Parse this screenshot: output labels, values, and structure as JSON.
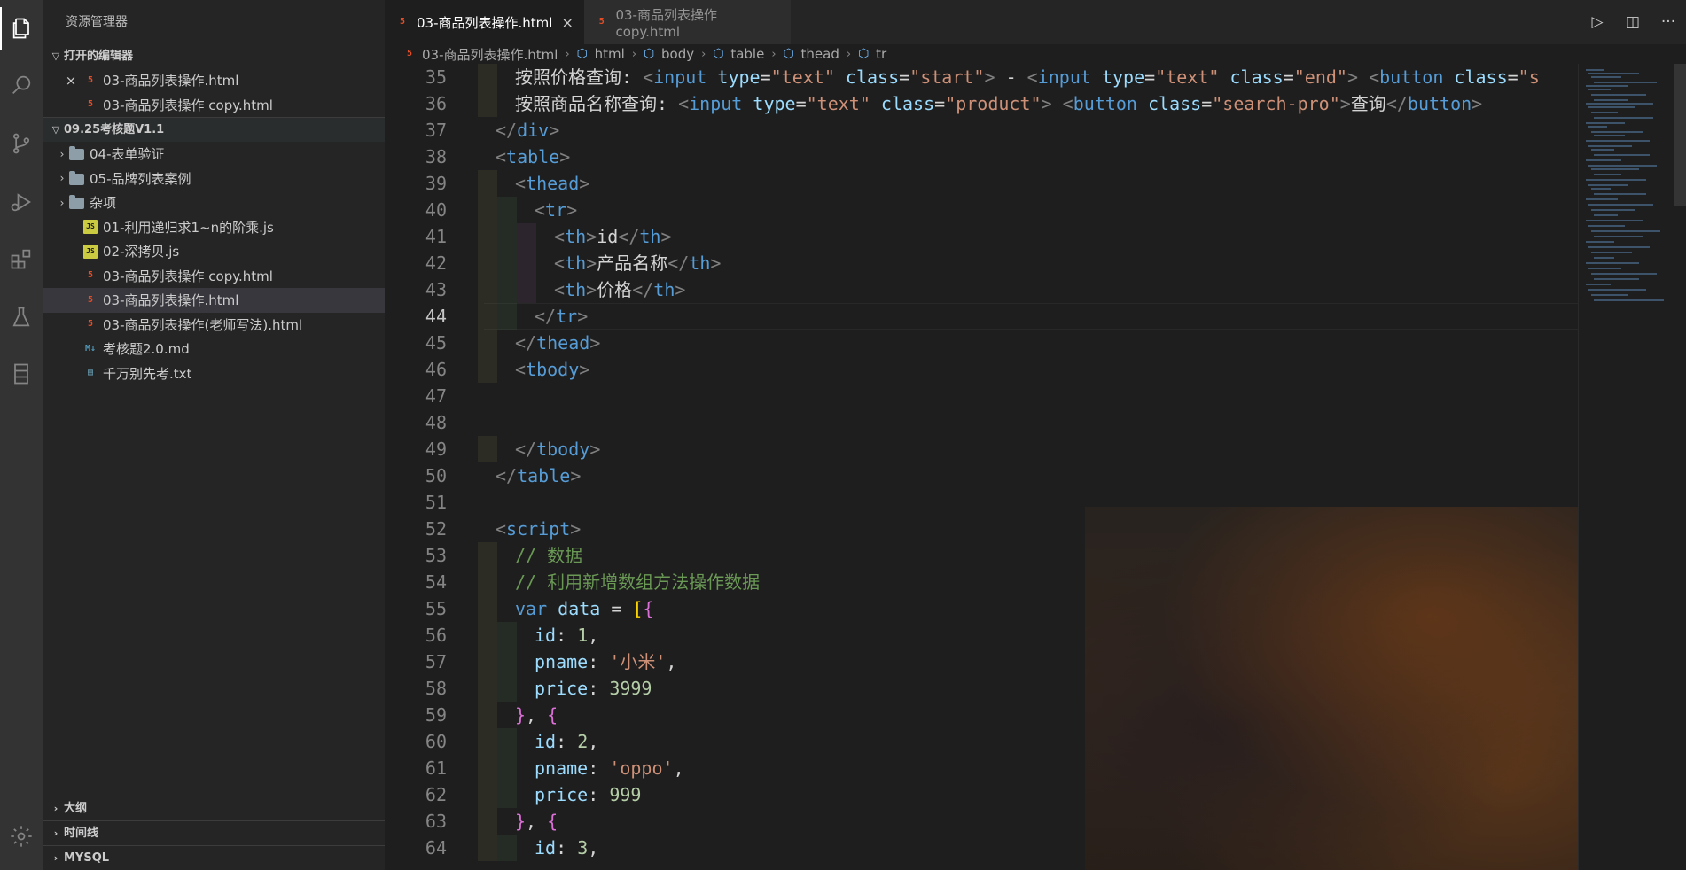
{
  "explorer": {
    "title": "资源管理器",
    "open_editors_header": "打开的编辑器",
    "open_editors": [
      {
        "name": "03-商品列表操作.html",
        "type": "html",
        "closable": true
      },
      {
        "name": "03-商品列表操作 copy.html",
        "type": "html",
        "closable": false
      }
    ],
    "project_header": "09.25考核题V1.1",
    "tree": [
      {
        "name": "04-表单验证",
        "kind": "folder"
      },
      {
        "name": "05-品牌列表案例",
        "kind": "folder"
      },
      {
        "name": "杂项",
        "kind": "folder"
      },
      {
        "name": "01-利用递归求1~n的阶乘.js",
        "kind": "js"
      },
      {
        "name": "02-深拷贝.js",
        "kind": "js"
      },
      {
        "name": "03-商品列表操作 copy.html",
        "kind": "html"
      },
      {
        "name": "03-商品列表操作.html",
        "kind": "html",
        "selected": true
      },
      {
        "name": "03-商品列表操作(老师写法).html",
        "kind": "html"
      },
      {
        "name": "考核题2.0.md",
        "kind": "md"
      },
      {
        "name": "千万别先考.txt",
        "kind": "txt"
      }
    ],
    "bottom_sections": [
      "大纲",
      "时间线",
      "MYSQL"
    ]
  },
  "tabs": [
    {
      "label": "03-商品列表操作.html",
      "active": true
    },
    {
      "label": "03-商品列表操作 copy.html",
      "active": false
    }
  ],
  "breadcrumb": [
    "03-商品列表操作.html",
    "html",
    "body",
    "table",
    "thead",
    "tr"
  ],
  "editor": {
    "current_line": 44,
    "lines": [
      {
        "n": 35,
        "indent": 1,
        "tokens": [
          [
            "text",
            "按照价格查询: "
          ],
          [
            "punc",
            "<"
          ],
          [
            "tag",
            "input"
          ],
          [
            "text",
            " "
          ],
          [
            "attr",
            "type"
          ],
          [
            "text",
            "="
          ],
          [
            "str",
            "\"text\""
          ],
          [
            "text",
            " "
          ],
          [
            "attr",
            "class"
          ],
          [
            "text",
            "="
          ],
          [
            "str",
            "\"start\""
          ],
          [
            "punc",
            ">"
          ],
          [
            "text",
            " - "
          ],
          [
            "punc",
            "<"
          ],
          [
            "tag",
            "input"
          ],
          [
            "text",
            " "
          ],
          [
            "attr",
            "type"
          ],
          [
            "text",
            "="
          ],
          [
            "str",
            "\"text\""
          ],
          [
            "text",
            " "
          ],
          [
            "attr",
            "class"
          ],
          [
            "text",
            "="
          ],
          [
            "str",
            "\"end\""
          ],
          [
            "punc",
            ">"
          ],
          [
            "text",
            " "
          ],
          [
            "punc",
            "<"
          ],
          [
            "tag",
            "button"
          ],
          [
            "text",
            " "
          ],
          [
            "attr",
            "class"
          ],
          [
            "text",
            "="
          ],
          [
            "str",
            "\"s"
          ]
        ]
      },
      {
        "n": 36,
        "indent": 1,
        "tokens": [
          [
            "text",
            "按照商品名称查询: "
          ],
          [
            "punc",
            "<"
          ],
          [
            "tag",
            "input"
          ],
          [
            "text",
            " "
          ],
          [
            "attr",
            "type"
          ],
          [
            "text",
            "="
          ],
          [
            "str",
            "\"text\""
          ],
          [
            "text",
            " "
          ],
          [
            "attr",
            "class"
          ],
          [
            "text",
            "="
          ],
          [
            "str",
            "\"product\""
          ],
          [
            "punc",
            ">"
          ],
          [
            "text",
            " "
          ],
          [
            "punc",
            "<"
          ],
          [
            "tag",
            "button"
          ],
          [
            "text",
            " "
          ],
          [
            "attr",
            "class"
          ],
          [
            "text",
            "="
          ],
          [
            "str",
            "\"search-pro\""
          ],
          [
            "punc",
            ">"
          ],
          [
            "text",
            "查询"
          ],
          [
            "punc",
            "</"
          ],
          [
            "tag",
            "button"
          ],
          [
            "punc",
            ">"
          ]
        ]
      },
      {
        "n": 37,
        "indent": 0,
        "tokens": [
          [
            "punc",
            "</"
          ],
          [
            "tag",
            "div"
          ],
          [
            "punc",
            ">"
          ]
        ]
      },
      {
        "n": 38,
        "indent": 0,
        "tokens": [
          [
            "punc",
            "<"
          ],
          [
            "tag",
            "table"
          ],
          [
            "punc",
            ">"
          ]
        ]
      },
      {
        "n": 39,
        "indent": 1,
        "tokens": [
          [
            "punc",
            "<"
          ],
          [
            "tag",
            "thead"
          ],
          [
            "punc",
            ">"
          ]
        ]
      },
      {
        "n": 40,
        "indent": 2,
        "tokens": [
          [
            "punc",
            "<"
          ],
          [
            "tag",
            "tr"
          ],
          [
            "punc",
            ">"
          ]
        ]
      },
      {
        "n": 41,
        "indent": 3,
        "tokens": [
          [
            "punc",
            "<"
          ],
          [
            "tag",
            "th"
          ],
          [
            "punc",
            ">"
          ],
          [
            "text",
            "id"
          ],
          [
            "punc",
            "</"
          ],
          [
            "tag",
            "th"
          ],
          [
            "punc",
            ">"
          ]
        ]
      },
      {
        "n": 42,
        "indent": 3,
        "tokens": [
          [
            "punc",
            "<"
          ],
          [
            "tag",
            "th"
          ],
          [
            "punc",
            ">"
          ],
          [
            "text",
            "产品名称"
          ],
          [
            "punc",
            "</"
          ],
          [
            "tag",
            "th"
          ],
          [
            "punc",
            ">"
          ]
        ]
      },
      {
        "n": 43,
        "indent": 3,
        "tokens": [
          [
            "punc",
            "<"
          ],
          [
            "tag",
            "th"
          ],
          [
            "punc",
            ">"
          ],
          [
            "text",
            "价格"
          ],
          [
            "punc",
            "</"
          ],
          [
            "tag",
            "th"
          ],
          [
            "punc",
            ">"
          ]
        ]
      },
      {
        "n": 44,
        "indent": 2,
        "tokens": [
          [
            "punc",
            "</"
          ],
          [
            "tag",
            "tr"
          ],
          [
            "punc",
            ">"
          ]
        ]
      },
      {
        "n": 45,
        "indent": 1,
        "tokens": [
          [
            "punc",
            "</"
          ],
          [
            "tag",
            "thead"
          ],
          [
            "punc",
            ">"
          ]
        ]
      },
      {
        "n": 46,
        "indent": 1,
        "tokens": [
          [
            "punc",
            "<"
          ],
          [
            "tag",
            "tbody"
          ],
          [
            "punc",
            ">"
          ]
        ]
      },
      {
        "n": 47,
        "indent": 0,
        "tokens": []
      },
      {
        "n": 48,
        "indent": 0,
        "tokens": []
      },
      {
        "n": 49,
        "indent": 1,
        "tokens": [
          [
            "punc",
            "</"
          ],
          [
            "tag",
            "tbody"
          ],
          [
            "punc",
            ">"
          ]
        ]
      },
      {
        "n": 50,
        "indent": 0,
        "tokens": [
          [
            "punc",
            "</"
          ],
          [
            "tag",
            "table"
          ],
          [
            "punc",
            ">"
          ]
        ]
      },
      {
        "n": 51,
        "indent": 0,
        "tokens": []
      },
      {
        "n": 52,
        "indent": 0,
        "tokens": [
          [
            "punc",
            "<"
          ],
          [
            "tag",
            "script"
          ],
          [
            "punc",
            ">"
          ]
        ]
      },
      {
        "n": 53,
        "indent": 1,
        "tokens": [
          [
            "comment",
            "// 数据"
          ]
        ]
      },
      {
        "n": 54,
        "indent": 1,
        "tokens": [
          [
            "comment",
            "// 利用新增数组方法操作数据"
          ]
        ]
      },
      {
        "n": 55,
        "indent": 1,
        "tokens": [
          [
            "kw",
            "var"
          ],
          [
            "text",
            " "
          ],
          [
            "var",
            "data"
          ],
          [
            "text",
            " = "
          ],
          [
            "bracket",
            "["
          ],
          [
            "brace",
            "{"
          ]
        ]
      },
      {
        "n": 56,
        "indent": 2,
        "tokens": [
          [
            "var",
            "id"
          ],
          [
            "text",
            ": "
          ],
          [
            "num",
            "1"
          ],
          [
            "text",
            ","
          ]
        ]
      },
      {
        "n": 57,
        "indent": 2,
        "tokens": [
          [
            "var",
            "pname"
          ],
          [
            "text",
            ": "
          ],
          [
            "str",
            "'小米'"
          ],
          [
            "text",
            ","
          ]
        ]
      },
      {
        "n": 58,
        "indent": 2,
        "tokens": [
          [
            "var",
            "price"
          ],
          [
            "text",
            ": "
          ],
          [
            "num",
            "3999"
          ]
        ]
      },
      {
        "n": 59,
        "indent": 1,
        "tokens": [
          [
            "brace",
            "}"
          ],
          [
            "text",
            ", "
          ],
          [
            "brace",
            "{"
          ]
        ]
      },
      {
        "n": 60,
        "indent": 2,
        "tokens": [
          [
            "var",
            "id"
          ],
          [
            "text",
            ": "
          ],
          [
            "num",
            "2"
          ],
          [
            "text",
            ","
          ]
        ]
      },
      {
        "n": 61,
        "indent": 2,
        "tokens": [
          [
            "var",
            "pname"
          ],
          [
            "text",
            ": "
          ],
          [
            "str",
            "'oppo'"
          ],
          [
            "text",
            ","
          ]
        ]
      },
      {
        "n": 62,
        "indent": 2,
        "tokens": [
          [
            "var",
            "price"
          ],
          [
            "text",
            ": "
          ],
          [
            "num",
            "999"
          ]
        ]
      },
      {
        "n": 63,
        "indent": 1,
        "tokens": [
          [
            "brace",
            "}"
          ],
          [
            "text",
            ", "
          ],
          [
            "brace",
            "{"
          ]
        ]
      },
      {
        "n": 64,
        "indent": 2,
        "tokens": [
          [
            "var",
            "id"
          ],
          [
            "text",
            ": "
          ],
          [
            "num",
            "3"
          ],
          [
            "text",
            ","
          ]
        ]
      }
    ]
  },
  "colors": {
    "accent": "#007acc",
    "html_icon": "#e44d26",
    "js_icon": "#cbcb41"
  }
}
